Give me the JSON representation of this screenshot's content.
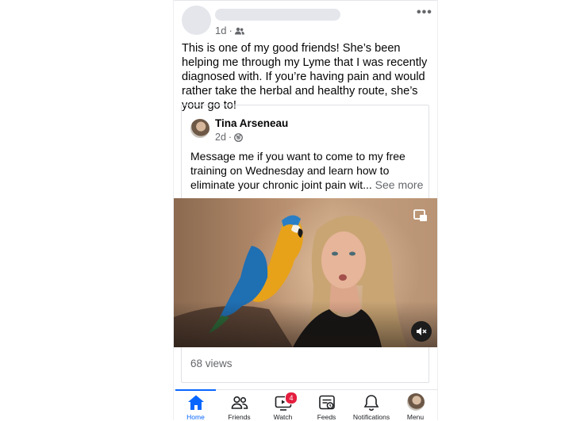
{
  "post": {
    "time": "1d",
    "audience_icon": "friends-icon",
    "more_icon": "more-dots-icon",
    "text": "This is one of my good friends! She’s been helping me through my Lyme that I was recently diagnosed with. If you’re having pain and would rather take the herbal and healthy route, she’s your go to!"
  },
  "shared": {
    "author": "Tina Arseneau",
    "time": "2d",
    "audience_icon": "globe-icon",
    "text": "Message me if you want to come to my free training on Wednesday and learn how to eliminate your chronic joint pain wit...",
    "see_more": "See more",
    "views": "68 views"
  },
  "video": {
    "pip_icon": "picture-in-picture-icon",
    "mute_icon": "muted-speaker-icon"
  },
  "tabs": [
    {
      "label": "Home",
      "icon": "home-icon",
      "active": true
    },
    {
      "label": "Friends",
      "icon": "friends-icon"
    },
    {
      "label": "Watch",
      "icon": "watch-icon",
      "badge": "4"
    },
    {
      "label": "Feeds",
      "icon": "feeds-icon"
    },
    {
      "label": "Notifications",
      "icon": "bell-icon"
    },
    {
      "label": "Menu",
      "icon": "profile-avatar"
    }
  ],
  "colors": {
    "accent": "#0866ff",
    "badge": "#e41e3f",
    "secondary_text": "#65676b"
  }
}
